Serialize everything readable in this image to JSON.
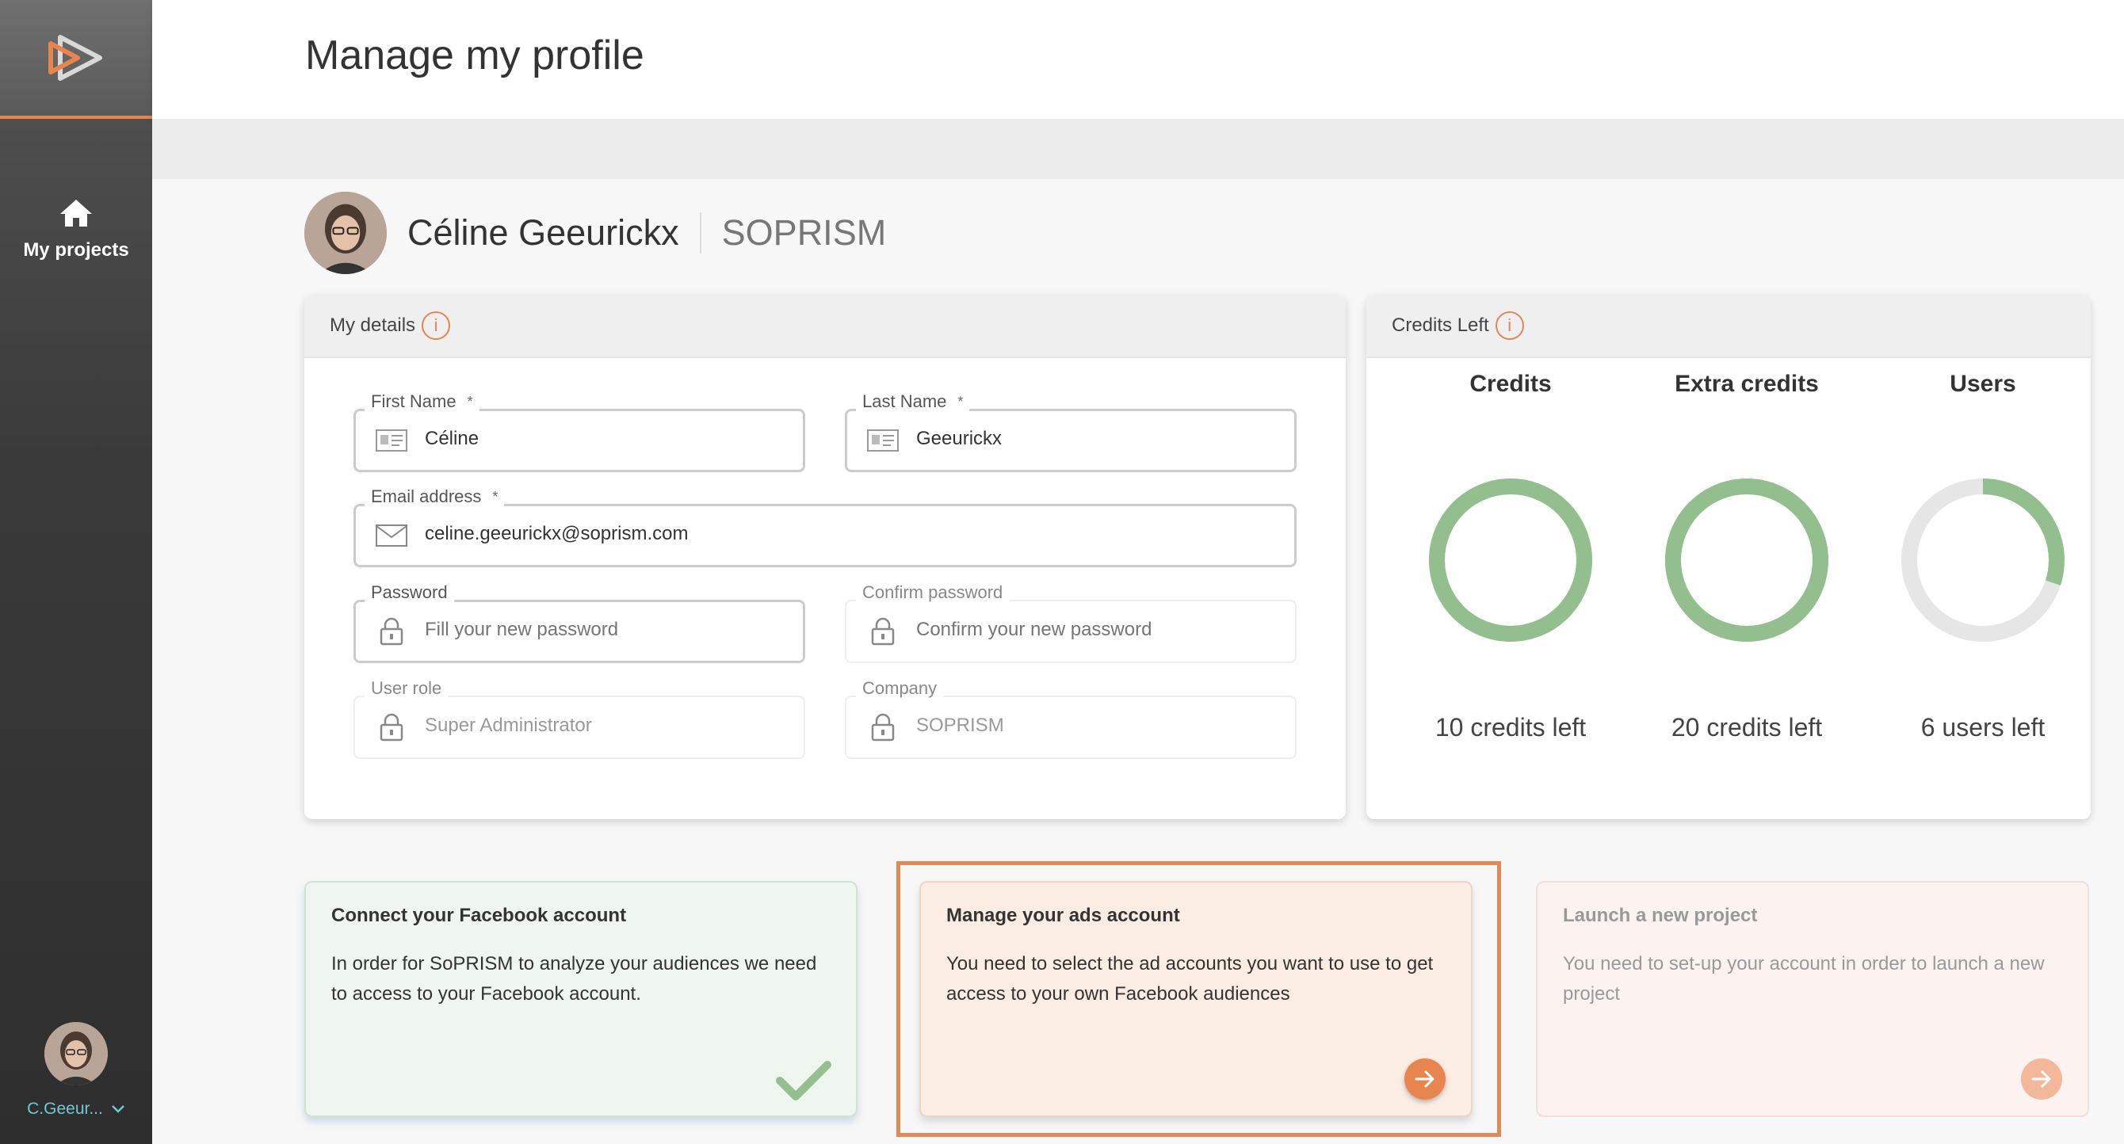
{
  "header": {
    "title": "Manage my profile"
  },
  "sidebar": {
    "nav": [
      {
        "label": "My projects",
        "icon": "home-icon"
      }
    ],
    "user": {
      "short_name": "C.Geeur..."
    }
  },
  "profile": {
    "name": "Céline Geeurickx",
    "company": "SOPRISM"
  },
  "details": {
    "title": "My details",
    "required_mark": "*",
    "first_name": {
      "label": "First Name",
      "value": "Céline"
    },
    "last_name": {
      "label": "Last Name",
      "value": "Geeurickx"
    },
    "email": {
      "label": "Email address",
      "value": "celine.geeurickx@soprism.com"
    },
    "password": {
      "label": "Password",
      "placeholder": "Fill your new password"
    },
    "confirm_password": {
      "label": "Confirm password",
      "placeholder": "Confirm your new password"
    },
    "user_role": {
      "label": "User role",
      "value": "Super Administrator"
    },
    "company": {
      "label": "Company",
      "value": "SOPRISM"
    }
  },
  "credits": {
    "title": "Credits Left",
    "items": [
      {
        "title": "Credits",
        "left_text": "10 credits left",
        "fraction": 1.0
      },
      {
        "title": "Extra credits",
        "left_text": "20 credits left",
        "fraction": 1.0
      },
      {
        "title": "Users",
        "left_text": "6 users left",
        "fraction": 0.3
      }
    ],
    "colors": {
      "fill": "#93bf8f",
      "track": "#e6e6e6"
    }
  },
  "steps": [
    {
      "title": "Connect your Facebook account",
      "text": "In order for SoPRISM to analyze your audiences we need to access to your Facebook account."
    },
    {
      "title": "Manage your ads account",
      "text": "You need to select the ad accounts you want to use to get access to your own Facebook audiences"
    },
    {
      "title": "Launch a new project",
      "text": "You need to set-up your account in order to launch a new project"
    }
  ],
  "colors": {
    "accent": "#e8844e",
    "success": "#93bf8f",
    "username": "#6fc8d4"
  }
}
